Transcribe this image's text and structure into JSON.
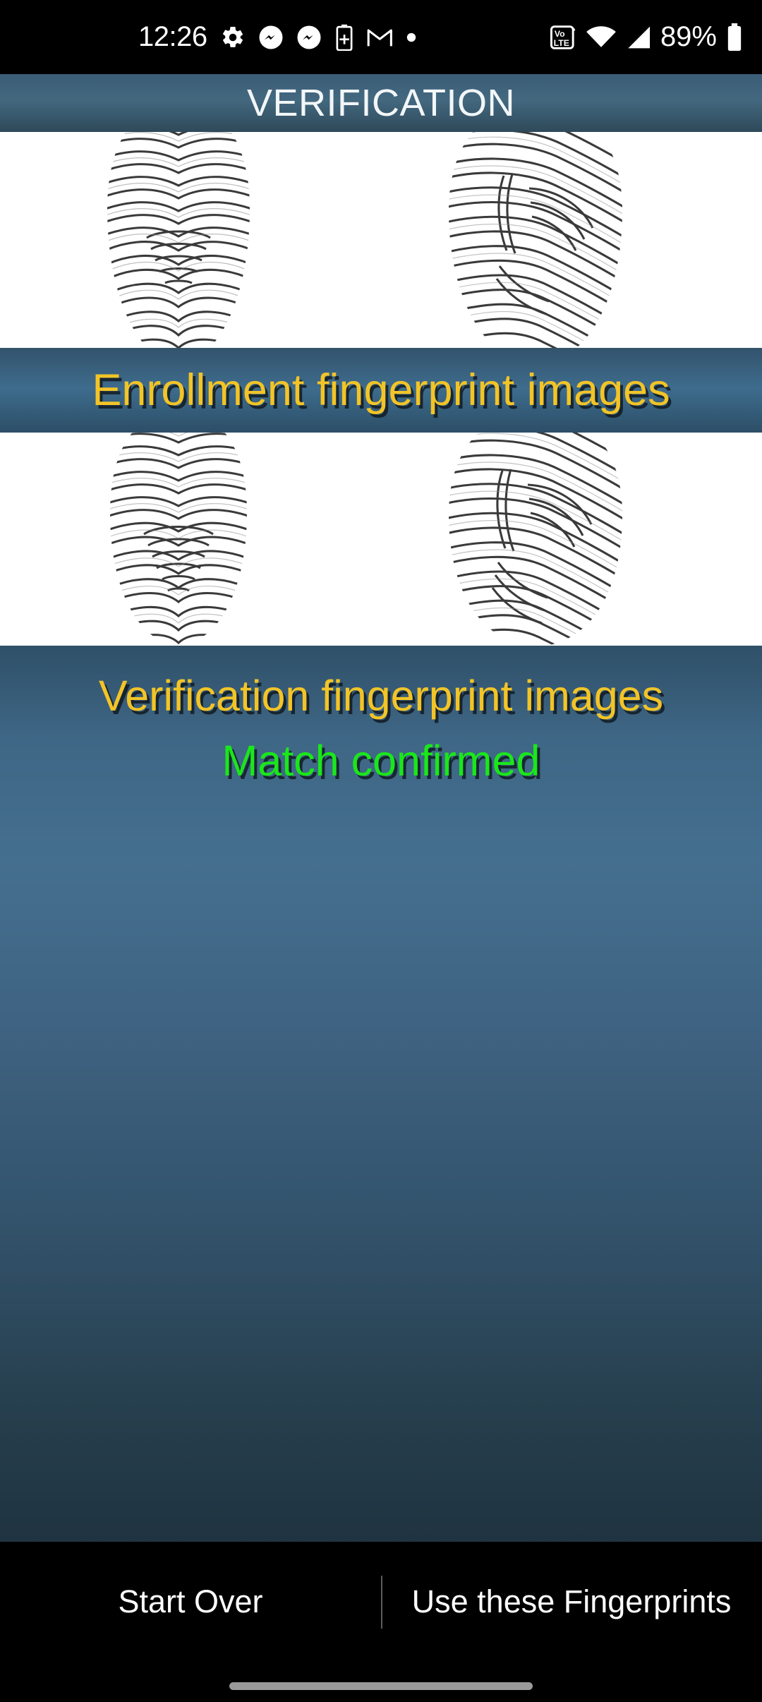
{
  "status_bar": {
    "time": "12:26",
    "battery_percent": "89%",
    "left_icons": [
      "gear-icon",
      "messenger-icon",
      "messenger-icon",
      "battery-plus-icon",
      "gmail-icon",
      "dot-icon"
    ],
    "right_icons": [
      "volte-icon",
      "wifi-icon",
      "cellular-signal-icon",
      "battery-icon"
    ],
    "volte_label_top": "Vo",
    "volte_label_bottom": "LTE"
  },
  "title_bar": {
    "title": "VERIFICATION"
  },
  "enrollment": {
    "caption": "Enrollment fingerprint images",
    "image_count": 2,
    "slots": [
      "enrollment-fingerprint-left",
      "enrollment-fingerprint-right"
    ]
  },
  "verification": {
    "caption": "Verification fingerprint images",
    "match_status": "Match confirmed",
    "image_count": 2,
    "slots": [
      "verification-fingerprint-left",
      "verification-fingerprint-right"
    ]
  },
  "footer": {
    "start_over_label": "Start Over",
    "use_fingerprints_label": "Use these Fingerprints"
  },
  "colors": {
    "caption_yellow": "#f2c427",
    "match_green": "#1ae71a",
    "title_text": "#f2f6f8",
    "band_blue": "#3e6c8d",
    "background_blue": "#3c6280",
    "footer_black": "#000000",
    "gesture_pill_gray": "#9a9a9a"
  }
}
